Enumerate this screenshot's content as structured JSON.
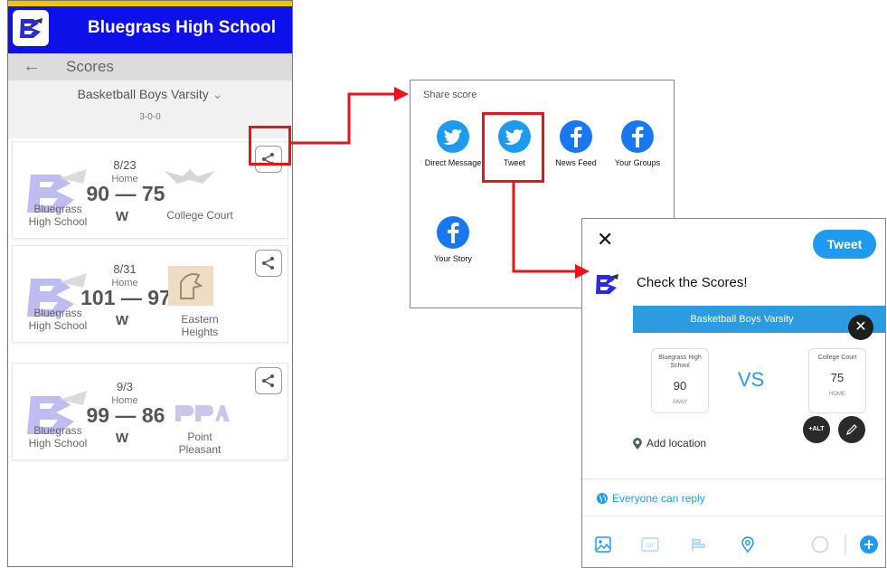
{
  "phone": {
    "app_title": "Bluegrass High School",
    "scores_title": "Scores",
    "filter_label": "Basketball Boys Varsity",
    "record": "3-0-0",
    "games": [
      {
        "date": "8/23",
        "home_away": "Home",
        "score": "90 — 75",
        "team": "Bluegrass\nHigh School",
        "result": "W",
        "opponent": "College Court"
      },
      {
        "date": "8/31",
        "home_away": "Home",
        "score": "101 — 97",
        "team": "Bluegrass\nHigh School",
        "result": "W",
        "opponent": "Eastern\nHeights"
      },
      {
        "date": "9/3",
        "home_away": "Home",
        "score": "99 — 86",
        "team": "Bluegrass\nHigh School",
        "result": "W",
        "opponent": "Point\nPleasant"
      }
    ]
  },
  "share_panel": {
    "header": "Share score",
    "options": [
      {
        "label": "Direct Message",
        "icon": "twitter-icon"
      },
      {
        "label": "Tweet",
        "icon": "twitter-icon"
      },
      {
        "label": "News Feed",
        "icon": "facebook-icon"
      },
      {
        "label": "Your Groups",
        "icon": "facebook-icon"
      },
      {
        "label": "Your Story",
        "icon": "facebook-icon"
      }
    ]
  },
  "tweet_panel": {
    "tweet_button": "Tweet",
    "message": "Check the Scores!",
    "card_header": "Basketball Boys Varsity",
    "home_team": {
      "name": "Bluegrass High School",
      "score": "90",
      "location": "AWAY"
    },
    "vs": "VS",
    "away_team": {
      "name": "College Court",
      "score": "75",
      "location": "HOME"
    },
    "alt_label": "+ALT",
    "add_location": "Add location",
    "reply_setting": "Everyone can reply"
  },
  "colors": {
    "app_blue": "#0d10e8",
    "accent_yellow": "#f2c400",
    "twitter_blue": "#1d9bf0",
    "facebook_blue": "#1877f2",
    "highlight_red": "#e8141a"
  }
}
